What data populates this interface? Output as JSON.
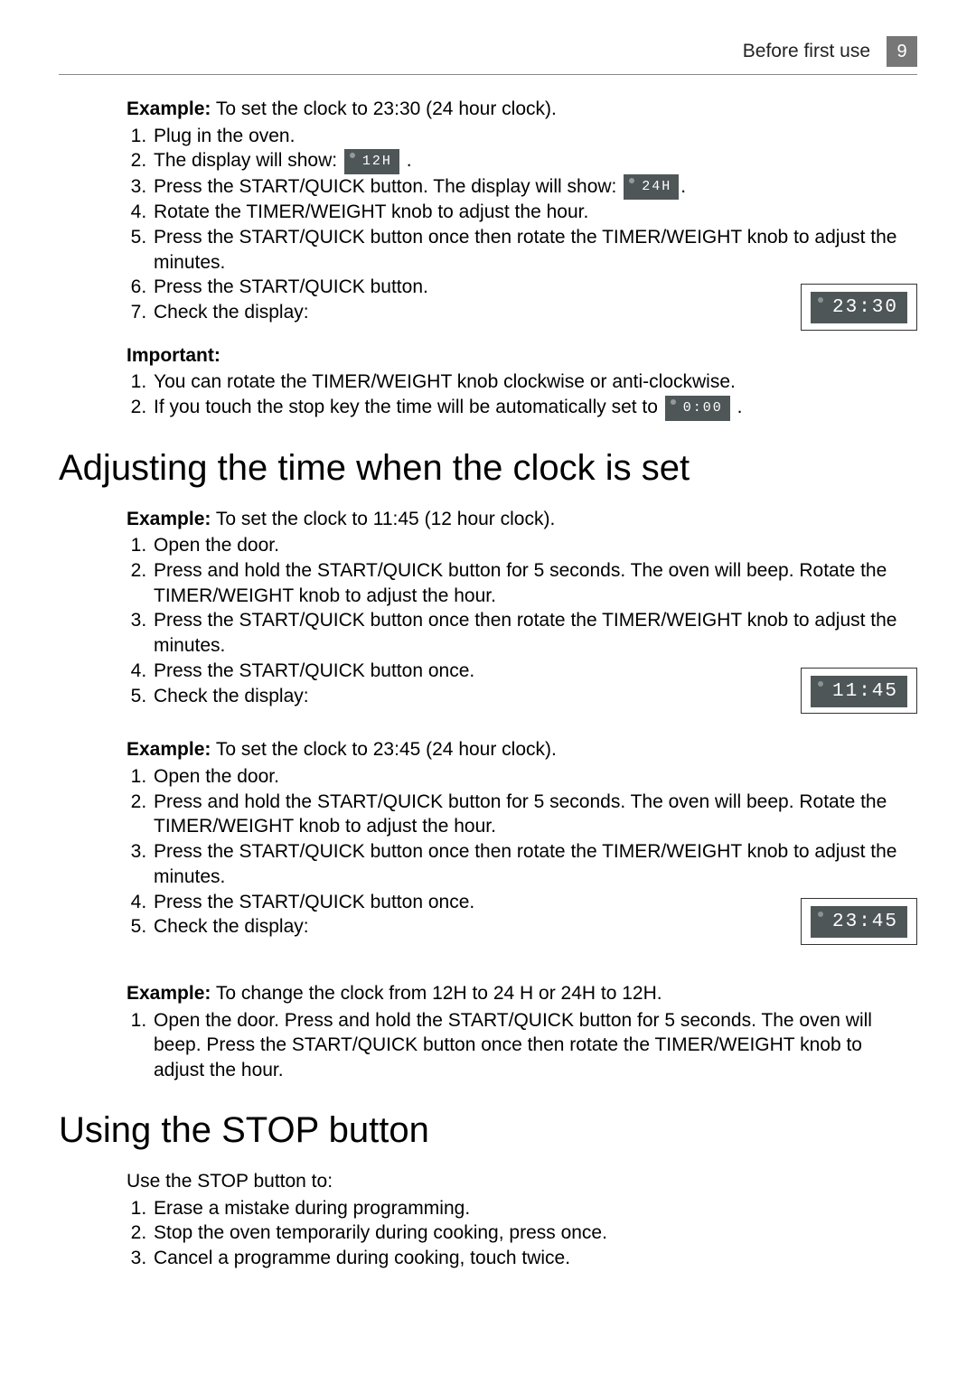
{
  "header": {
    "section": "Before first use",
    "page": "9"
  },
  "sec1": {
    "ex_label": "Example:",
    "ex_text": " To set the clock to 23:30 (24 hour clock).",
    "s1": "Plug in the oven.",
    "s2a": "The display will show: ",
    "s2_disp": "12H",
    "s2b": " .",
    "s3a": "Press the START/QUICK button. The display will show: ",
    "s3_disp": "24H",
    "s3b": ".",
    "s4": "Rotate the TIMER/WEIGHT knob to adjust the hour.",
    "s5": "Press the START/QUICK button once then rotate the TIMER/WEIGHT knob to adjust the minutes.",
    "s6": "Press the START/QUICK button.",
    "s7": "Check the display:",
    "disp_big": "23:30",
    "imp_label": "Important:",
    "imp1": "You can rotate the TIMER/WEIGHT knob clockwise or anti-clockwise.",
    "imp2a": "If you touch the stop key the time will be automatically set to ",
    "imp2_disp": "0:00",
    "imp2b": " ."
  },
  "sec2": {
    "title": "Adjusting the time when the clock is set",
    "ex1_label": "Example:",
    "ex1_text": " To set the clock to 11:45 (12 hour clock).",
    "a1": "Open the door.",
    "a2": "Press and hold the START/QUICK button for 5 seconds. The oven will beep. Rotate the TIMER/WEIGHT knob to adjust the hour.",
    "a3": "Press the START/QUICK button once then rotate the TIMER/WEIGHT knob to adjust the minutes.",
    "a4": "Press the START/QUICK button once.",
    "a5": "Check the display:",
    "disp_a": "11:45",
    "ex2_label": "Example:",
    "ex2_text": " To set the clock to 23:45 (24 hour clock).",
    "b1": "Open the door.",
    "b2": "Press and hold the START/QUICK button for 5 seconds. The oven will beep. Rotate the TIMER/WEIGHT knob to adjust the hour.",
    "b3": "Press the START/QUICK button once then rotate the TIMER/WEIGHT knob to adjust the minutes.",
    "b4": "Press the START/QUICK button once.",
    "b5": "Check the display:",
    "disp_b": "23:45",
    "ex3_label": "Example:",
    "ex3_text": " To change the clock from 12H to 24 H or 24H to 12H.",
    "c1": "Open the door. Press and hold the START/QUICK button for 5 seconds. The oven will beep. Press the START/QUICK button once then rotate the TIMER/WEIGHT knob to adjust the hour."
  },
  "sec3": {
    "title": "Using the STOP button",
    "intro": "Use the STOP button to:",
    "s1": "Erase a mistake during programming.",
    "s2": "Stop the oven temporarily during cooking, press once.",
    "s3": "Cancel a programme during cooking, touch twice."
  }
}
